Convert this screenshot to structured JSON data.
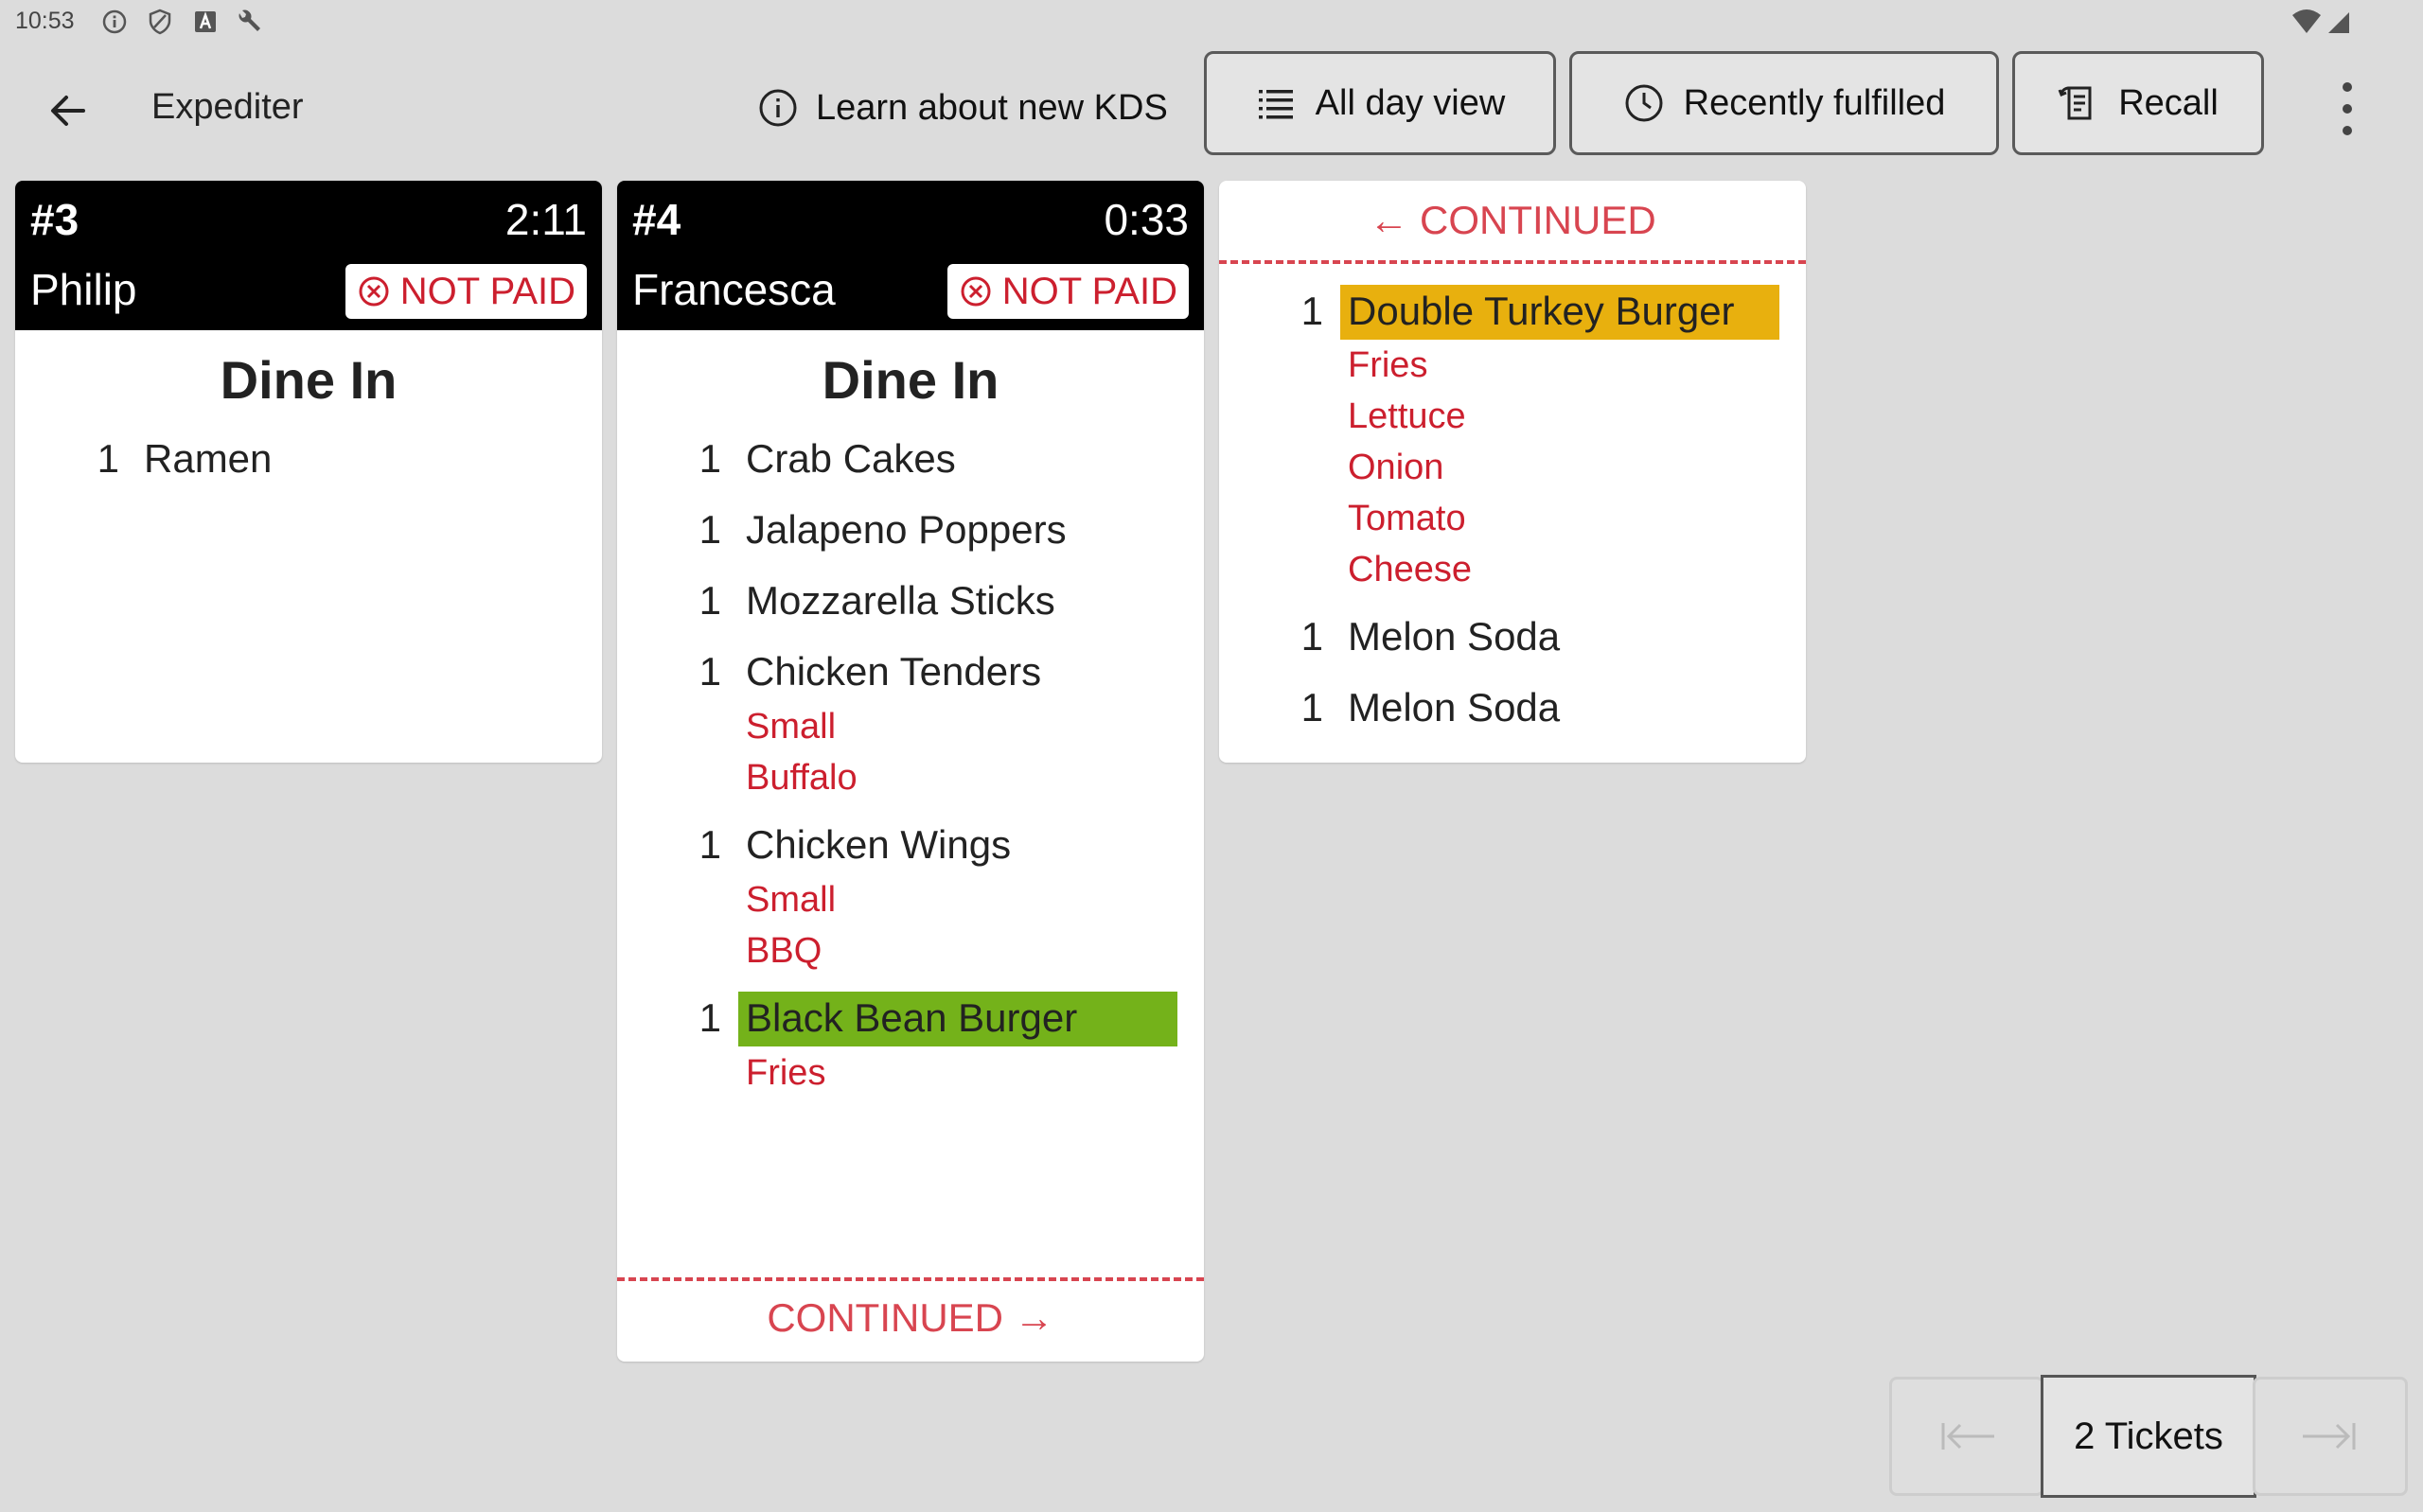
{
  "status_bar": {
    "time": "10:53"
  },
  "app_bar": {
    "title": "Expediter",
    "learn_label": "Learn about new KDS",
    "all_day_label": "All day view",
    "recent_label": "Recently fulfilled",
    "recall_label": "Recall"
  },
  "tickets": [
    {
      "number": "#3",
      "time": "2:11",
      "name": "Philip",
      "paid_status": "NOT PAID",
      "order_type": "Dine In",
      "items": [
        {
          "qty": "1",
          "name": "Ramen"
        }
      ]
    },
    {
      "number": "#4",
      "time": "0:33",
      "name": "Francesca",
      "paid_status": "NOT PAID",
      "order_type": "Dine In",
      "items": [
        {
          "qty": "1",
          "name": "Crab Cakes"
        },
        {
          "qty": "1",
          "name": "Jalapeno Poppers"
        },
        {
          "qty": "1",
          "name": "Mozzarella Sticks"
        },
        {
          "qty": "1",
          "name": "Chicken Tenders",
          "mods": [
            "Small",
            "Buffalo"
          ]
        },
        {
          "qty": "1",
          "name": "Chicken Wings",
          "mods": [
            "Small",
            "BBQ"
          ]
        },
        {
          "qty": "1",
          "name": "Black Bean Burger",
          "mods": [
            "Fries"
          ],
          "highlight": "#74b21a"
        }
      ],
      "continued_label": "CONTINUED →"
    },
    {
      "continued_label": "← CONTINUED",
      "items": [
        {
          "qty": "1",
          "name": "Double Turkey Burger",
          "mods": [
            "Fries",
            "Lettuce",
            "Onion",
            "Tomato",
            "Cheese"
          ],
          "highlight": "#e8b00e"
        },
        {
          "qty": "1",
          "name": "Melon Soda"
        },
        {
          "qty": "1",
          "name": "Melon Soda"
        }
      ]
    }
  ],
  "pager": {
    "count_label": "2 Tickets"
  },
  "colors": {
    "modifier": "#cc1f2e",
    "continued": "#d84550",
    "ticket_header": "#000000"
  }
}
